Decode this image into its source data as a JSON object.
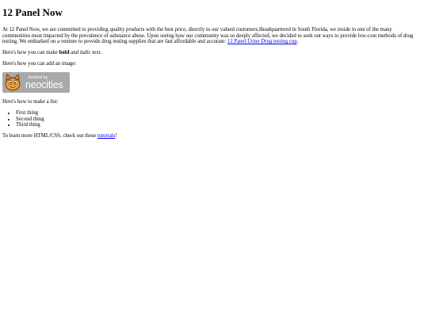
{
  "heading": "12 Panel Now",
  "intro": {
    "text": "At 12 Panel Now, we are committed to providing quality products with the best price, directly to our valued customers.Headquartered in South Florida, we reside in one of the many communities most impacted by the prevalence of substance abuse. Upon seeing how our community was so deeply affected, we decided to seek out ways to provide low-cost methods of drug testing. We embarked on a venture to provide drug testing supplies that are fast affordable and accurate: ",
    "link": "12 Panel Urine Drug testing cup",
    "end": "."
  },
  "bold_line": {
    "prefix": "Here's how you can make ",
    "bold": "bold",
    "middle": " and ",
    "italic": "italic",
    "suffix": " text."
  },
  "image_line": "Here's how you can add an image:",
  "badge": {
    "hosted": "hosted by",
    "brand": "neocities"
  },
  "list_line": "Here's how to make a list:",
  "list_items": [
    "First thing",
    "Second thing",
    "Third thing"
  ],
  "learn_line": {
    "prefix": "To learn more HTML/CSS, check out these ",
    "link": "tutorials",
    "suffix": "!"
  }
}
